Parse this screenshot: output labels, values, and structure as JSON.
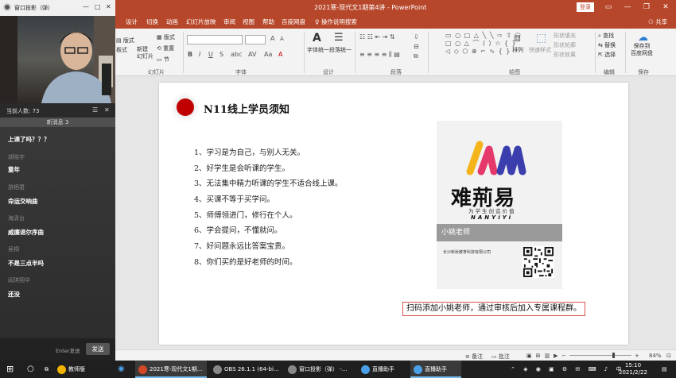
{
  "app": {
    "document_title": "2021寒-现代文1期第4讲 - PowerPoint",
    "login_label": "登录",
    "share_label": "共享",
    "search_hint": "操作说明搜索"
  },
  "ribbon_tabs": [
    "设计",
    "切换",
    "动画",
    "幻灯片放映",
    "审阅",
    "视图",
    "帮助",
    "百度网盘"
  ],
  "ribbon": {
    "layout_label": "版式",
    "reset_label": "重置",
    "section_label": "节",
    "new_slide_label": "新建\n幻灯片",
    "group_slides": "幻灯片",
    "group_font": "字体",
    "group_paragraph": "段落",
    "group_design": "设计",
    "group_drawing": "绘图",
    "group_editing": "编辑",
    "group_save": "保存",
    "font_unify_label": "字体统一",
    "para_unify_label": "段落统一",
    "arrange_label": "排列",
    "quick_style_label": "快速样式",
    "shape_fill": "形状填充",
    "shape_outline": "形状轮廓",
    "shape_effect": "形状效果",
    "find_label": "查找",
    "replace_label": "替换",
    "select_label": "选择",
    "save_baidu_label": "保存到\n百度网盘"
  },
  "slide": {
    "title": "N11线上学员须知",
    "rules": [
      "1、学习是为自己，与别人无关。",
      "2、好学生是会听课的学生。",
      "3、无法集中精力听课的学生不适合线上课。",
      "4、买课不等于买学问。",
      "5、师傅领进门，修行在个人。",
      "6、学会提问，不懂就问。",
      "7、好问题永远比答案宝贵。",
      "8、你们买的是好老师的时间。"
    ],
    "card": {
      "brand_cn": "难荊易",
      "slogan": "为学生创造价值",
      "brand_en": "NANYiYi",
      "teacher": "小姚老师",
      "company": "长沙新秋教育科技有限公司"
    },
    "note": "扫码添加小姚老师，通过审核后加入专属课程群。"
  },
  "status_bar": {
    "notes_label": "备注",
    "comments_label": "批注",
    "zoom": "84%"
  },
  "live_panel": {
    "window_title": "窗口投影（弹）",
    "viewer_count": "当前人数: 73",
    "new_messages": "新消息 3",
    "messages": [
      {
        "user": "",
        "text": "上课了吗？？？"
      },
      {
        "user": "胡晓宇",
        "text": "童年"
      },
      {
        "user": "游栖君",
        "text": "命运交响曲"
      },
      {
        "user": "海清台",
        "text": "威廉退尔序曲"
      },
      {
        "user": "吴桐",
        "text": "不是三点半吗"
      },
      {
        "user": "阎琪翔华",
        "text": "还没"
      }
    ],
    "enter_hint": "Enter发送",
    "send_label": "发送"
  },
  "taskbar": {
    "items": [
      {
        "label": "教师版",
        "color": "#f0b400"
      },
      {
        "label": "2021寒-现代文1期...",
        "color": "#d24726"
      },
      {
        "label": "OBS 26.1.1 (64-bi...",
        "color": "#888888"
      },
      {
        "label": "窗口投影（弹） -...",
        "color": "#888888"
      },
      {
        "label": "直播助手",
        "color": "#4aa0e6"
      },
      {
        "label": "直播助手",
        "color": "#4aa0e6"
      }
    ],
    "time": "15:10",
    "date": "2021/2/22"
  },
  "colors": {
    "ppt_accent": "#b7472a",
    "slide_dot": "#c00000",
    "note_border": "#d9534f"
  }
}
